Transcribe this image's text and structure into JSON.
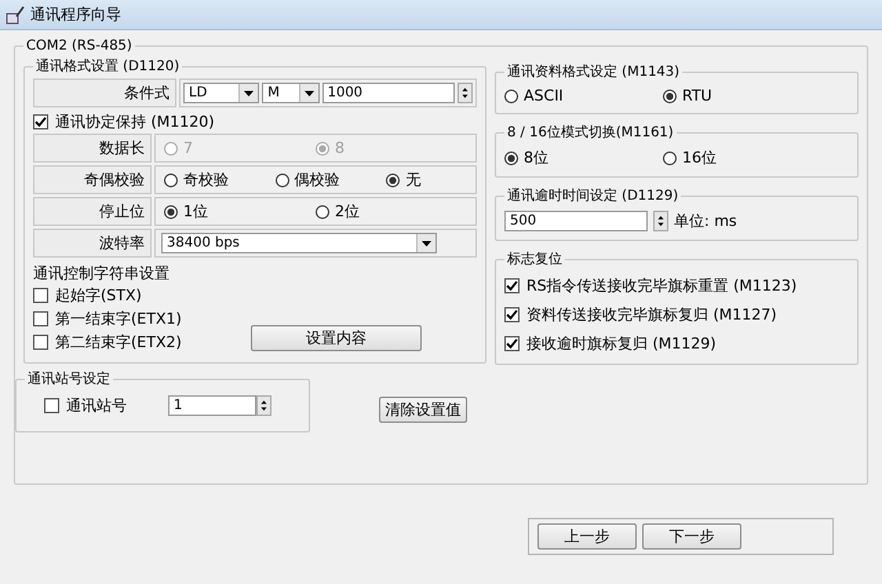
{
  "window": {
    "title": "通讯程序向导"
  },
  "port_group": {
    "title": "COM2 (RS-485)"
  },
  "format_group": {
    "title": "通讯格式设置 (D1120)",
    "condition": {
      "label": "条件式",
      "selects": [
        "LD",
        "M"
      ],
      "value": "1000"
    },
    "hold": {
      "label": "通讯协定保持 (M1120)",
      "checked": true
    },
    "rows": [
      {
        "kind": "radio",
        "label": "数据长",
        "disabled": true,
        "options": [
          {
            "label": "7",
            "selected": false
          },
          {
            "label": "8",
            "selected": true
          }
        ]
      },
      {
        "kind": "radio",
        "label": "奇偶校验",
        "disabled": false,
        "options": [
          {
            "label": "奇校验",
            "selected": false
          },
          {
            "label": "偶校验",
            "selected": false
          },
          {
            "label": "无",
            "selected": true
          }
        ]
      },
      {
        "kind": "radio",
        "label": "停止位",
        "disabled": false,
        "options": [
          {
            "label": "1位",
            "selected": true
          },
          {
            "label": "2位",
            "selected": false
          }
        ]
      },
      {
        "kind": "select",
        "label": "波特率",
        "value": "38400 bps"
      }
    ],
    "control_strings": {
      "title": "通讯控制字符串设置",
      "items": [
        {
          "label": "起始字(STX)",
          "checked": false
        },
        {
          "label": "第一结束字(ETX1)",
          "checked": false
        },
        {
          "label": "第二结束字(ETX2)",
          "checked": false
        }
      ],
      "button": "设置内容"
    }
  },
  "station_group": {
    "title": "通讯站号设定",
    "checkbox": {
      "label": "通讯站号",
      "checked": false
    },
    "value": "1"
  },
  "clear_button": "清除设置值",
  "data_format_group": {
    "title": "通讯资料格式设定 (M1143)",
    "options": [
      {
        "label": "ASCII",
        "selected": false
      },
      {
        "label": "RTU",
        "selected": true
      }
    ]
  },
  "mode_group": {
    "title": "8 / 16位模式切换(M1161)",
    "options": [
      {
        "label": "8位",
        "selected": true
      },
      {
        "label": "16位",
        "selected": false
      }
    ]
  },
  "timeout_group": {
    "title": "通讯逾时时间设定 (D1129)",
    "value": "500",
    "unit": "单位: ms"
  },
  "flag_group": {
    "title": "标志复位",
    "items": [
      {
        "label": "RS指令传送接收完毕旗标重置 (M1123)",
        "checked": true
      },
      {
        "label": "资料传送接收完毕旗标复归 (M1127)",
        "checked": true
      },
      {
        "label": "接收逾时旗标复归 (M1129)",
        "checked": true
      }
    ]
  },
  "footer": {
    "buttons": [
      "上一步",
      "下一步"
    ]
  }
}
